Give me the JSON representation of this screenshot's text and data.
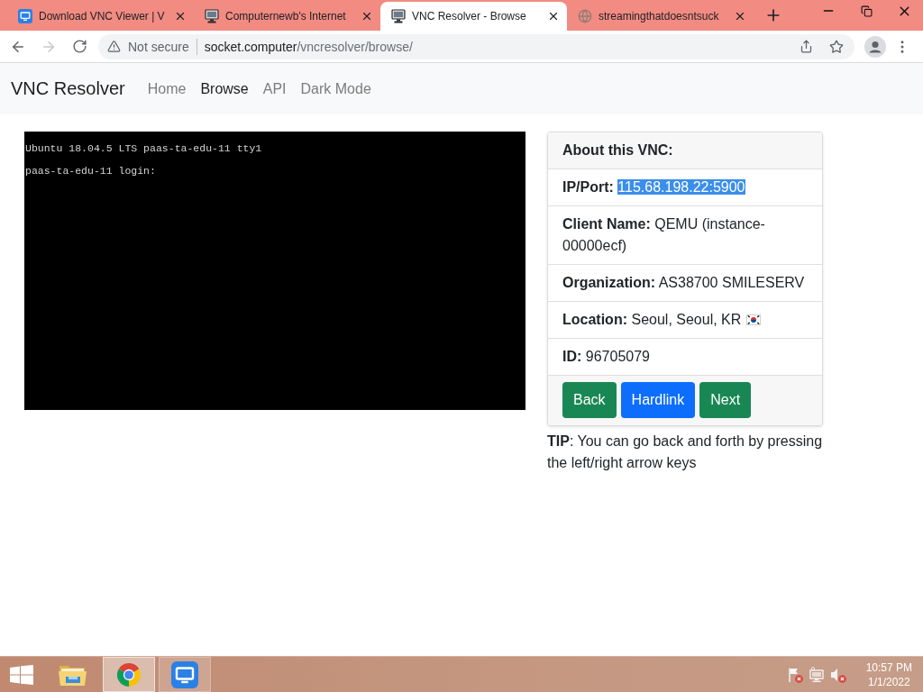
{
  "browser": {
    "tabs": [
      {
        "title": "Download VNC Viewer | V",
        "kind": "logo",
        "selected": false
      },
      {
        "title": "Computernewb's Internet",
        "kind": "computer",
        "selected": false
      },
      {
        "title": "VNC Resolver - Browse",
        "kind": "computer",
        "selected": true
      },
      {
        "title": "streamingthatdoesntsuck",
        "kind": "globe",
        "selected": false
      }
    ],
    "address_bar": {
      "security": "Not secure",
      "url_host": "socket.computer",
      "url_path": "/vncresolver/browse/"
    }
  },
  "navbar": {
    "brand": "VNC Resolver",
    "links": [
      {
        "label": "Home",
        "selected": false
      },
      {
        "label": "Browse",
        "selected": true
      },
      {
        "label": "API",
        "selected": false
      },
      {
        "label": "Dark Mode",
        "selected": false
      }
    ]
  },
  "terminal": {
    "lines": [
      "Ubuntu 18.04.5 LTS paas-ta-edu-11 tty1",
      "paas-ta-edu-11 login:"
    ]
  },
  "card": {
    "header": "About this VNC:",
    "fields": [
      {
        "label": "IP/Port:",
        "value": "115.68.198.22:5900",
        "highlighted": true,
        "flag": false
      },
      {
        "label": "Client Name:",
        "value": "QEMU (instance-00000ecf)",
        "highlighted": false,
        "flag": false
      },
      {
        "label": "Organization:",
        "value": "AS38700 SMILESERV",
        "highlighted": false,
        "flag": false
      },
      {
        "label": "Location:",
        "value": "Seoul, Seoul, KR",
        "highlighted": false,
        "flag": true
      },
      {
        "label": "ID:",
        "value": "96705079",
        "highlighted": false,
        "flag": false
      }
    ],
    "buttons": [
      {
        "label": "Back",
        "kind": "success"
      },
      {
        "label": "Hardlink",
        "kind": "primary"
      },
      {
        "label": "Next",
        "kind": "success"
      }
    ]
  },
  "tip": "**TIP**: You can go back and forth by pressing the left/right arrow keys",
  "taskbar": {
    "apps": [
      {
        "kind": "explorer",
        "running": false,
        "selected": false
      },
      {
        "kind": "chrome",
        "running": true,
        "selected": true
      },
      {
        "kind": "vnc",
        "running": true,
        "selected": false
      }
    ],
    "clock": {
      "time": "10:57 PM",
      "date": "1/1/2022"
    }
  }
}
